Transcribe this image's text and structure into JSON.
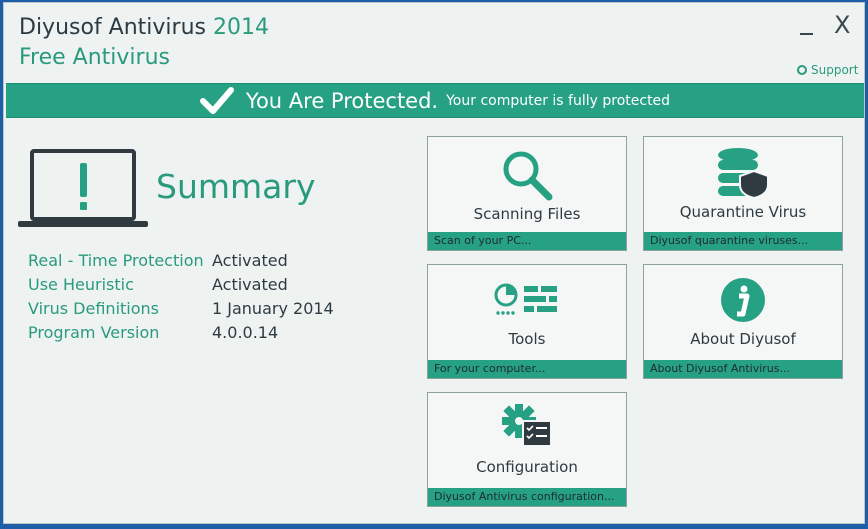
{
  "window": {
    "title_main": "Diyusof Antivirus",
    "title_year": "2014",
    "title_sub": "Free Antivirus",
    "minimize_label": "",
    "close_label": "X",
    "support_label": "Support"
  },
  "banner": {
    "status": "You Are Protected.",
    "detail": "Your computer is fully protected"
  },
  "summary": {
    "title": "Summary",
    "rows": [
      {
        "label": "Real - Time Protection",
        "value": "Activated"
      },
      {
        "label": "Use Heuristic",
        "value": "Activated"
      },
      {
        "label": "Virus Definitions",
        "value": "1 January 2014"
      },
      {
        "label": "Program Version",
        "value": "4.0.0.14"
      }
    ]
  },
  "tiles": [
    {
      "label": "Scanning Files",
      "footer": "Scan of your PC...",
      "icon": "magnifier-icon"
    },
    {
      "label": "Quarantine Virus",
      "footer": "Diyusof quarantine viruses...",
      "icon": "database-shield-icon"
    },
    {
      "label": "Tools",
      "footer": "For your computer...",
      "icon": "tools-icon"
    },
    {
      "label": "About Diyusof",
      "footer": "About Diyusof Antivirus...",
      "icon": "info-icon"
    },
    {
      "label": "Configuration",
      "footer": "Diyusof Antivirus configuration...",
      "icon": "gear-checklist-icon"
    }
  ],
  "colors": {
    "accent": "#26a183",
    "text": "#2e3b42",
    "background": "#eef3f2",
    "desktop": "#1e5ea8"
  }
}
